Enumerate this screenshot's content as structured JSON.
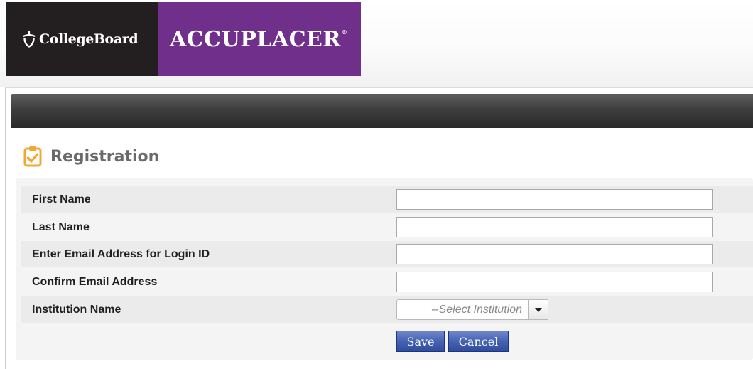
{
  "brand": {
    "collegeboard_text": "CollegeBoard",
    "accuplacer_text": "ACCUPLACER",
    "registered_mark": "®",
    "collegeboard_bg": "#231f20",
    "accuplacer_bg": "#702f8a"
  },
  "page": {
    "title": "Registration",
    "title_icon": "clipboard-check-icon"
  },
  "form": {
    "fields": [
      {
        "label": "First Name",
        "value": ""
      },
      {
        "label": "Last Name",
        "value": ""
      },
      {
        "label": "Enter Email Address for Login ID",
        "value": ""
      },
      {
        "label": "Confirm Email Address",
        "value": ""
      }
    ],
    "institution": {
      "label": "Institution Name",
      "selected": "--Select Institution"
    },
    "save_label": "Save",
    "cancel_label": "Cancel",
    "button_color": "#4563b4"
  }
}
